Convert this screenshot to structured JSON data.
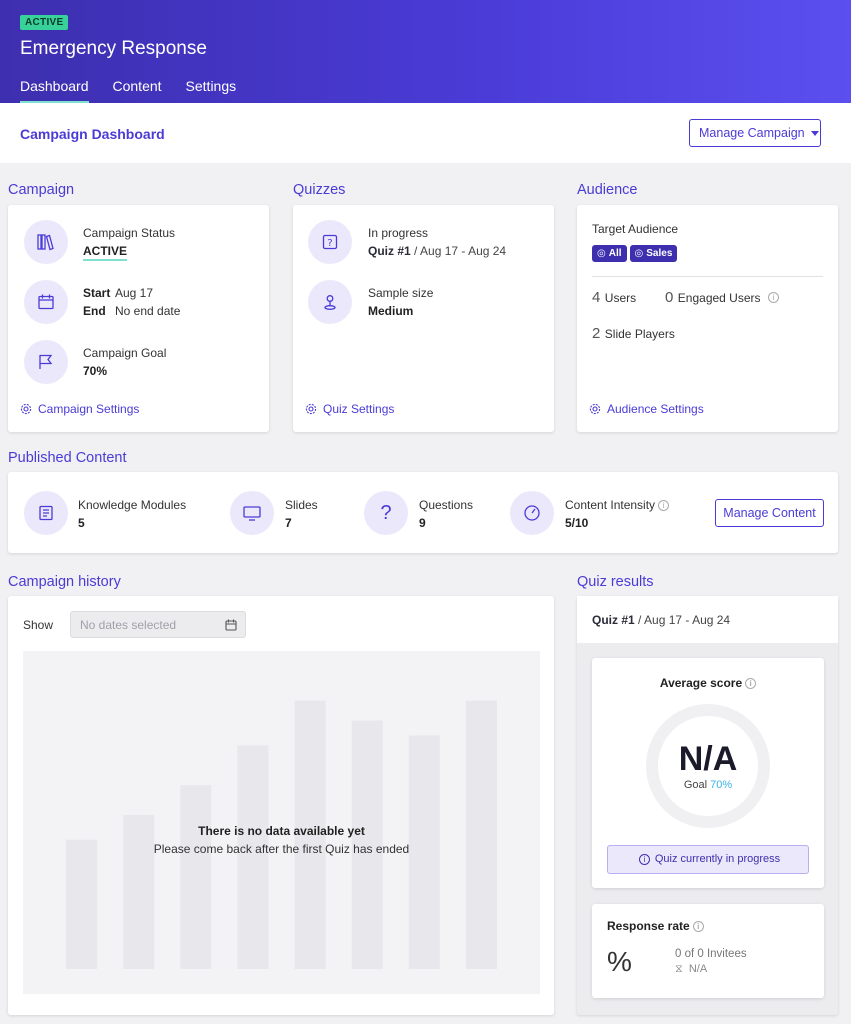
{
  "header": {
    "status_badge": "ACTIVE",
    "title": "Emergency Response",
    "tabs": [
      {
        "label": "Dashboard"
      },
      {
        "label": "Content"
      },
      {
        "label": "Settings"
      }
    ]
  },
  "subheader": {
    "title": "Campaign Dashboard",
    "manage_campaign_label": "Manage Campaign"
  },
  "campaign": {
    "section_title": "Campaign",
    "status_label": "Campaign Status",
    "status_value": "ACTIVE",
    "start_label": "Start",
    "start_value": "Aug 17",
    "end_label": "End",
    "end_value": "No end date",
    "goal_label": "Campaign Goal",
    "goal_value": "70%",
    "settings_link": "Campaign Settings"
  },
  "quizzes": {
    "section_title": "Quizzes",
    "progress_label": "In progress",
    "quiz_name": "Quiz #1",
    "quiz_dates": "/ Aug 17 - Aug 24",
    "sample_label": "Sample size",
    "sample_value": "Medium",
    "settings_link": "Quiz Settings"
  },
  "audience": {
    "section_title": "Audience",
    "target_label": "Target Audience",
    "tags": [
      "All",
      "Sales"
    ],
    "users_count": "4",
    "users_label": "Users",
    "engaged_count": "0",
    "engaged_label": "Engaged Users",
    "slide_players_count": "2",
    "slide_players_label": "Slide Players",
    "settings_link": "Audience Settings"
  },
  "published": {
    "section_title": "Published Content",
    "items": [
      {
        "label": "Knowledge Modules",
        "value": "5",
        "icon": "book-icon"
      },
      {
        "label": "Slides",
        "value": "7",
        "icon": "monitor-icon"
      },
      {
        "label": "Questions",
        "value": "9",
        "icon": "question-icon"
      },
      {
        "label": "Content Intensity",
        "value": "5/10",
        "icon": "gauge-icon"
      }
    ],
    "manage_content_label": "Manage Content"
  },
  "history": {
    "section_title": "Campaign history",
    "show_label": "Show",
    "date_placeholder": "No dates selected",
    "empty_title": "There is no data available yet",
    "empty_subtitle": "Please come back after the first Quiz has ended"
  },
  "chart_data": {
    "type": "bar",
    "categories": [
      "",
      "",
      "",
      "",
      "",
      "",
      "",
      ""
    ],
    "values": [
      26,
      31,
      37,
      45,
      54,
      50,
      47,
      54
    ],
    "ylim": [
      0,
      64
    ],
    "title": "",
    "xlabel": "",
    "ylabel": "",
    "grid": false,
    "color": "#e8e8ec"
  },
  "quiz_results": {
    "section_title": "Quiz results",
    "quiz_name": "Quiz #1",
    "quiz_dates": "/ Aug 17 - Aug 24",
    "avg_label": "Average score",
    "avg_value": "N/A",
    "goal_label": "Goal",
    "goal_value": "70%",
    "progress_notice": "Quiz currently in progress",
    "response_label": "Response rate",
    "response_symbol": "%",
    "invitees": "0 of 0 Invitees",
    "response_time": "N/A"
  },
  "colors": {
    "accent": "#4a3bd6",
    "active_badge": "#38d19a",
    "goal_highlight": "#37b4e8"
  }
}
